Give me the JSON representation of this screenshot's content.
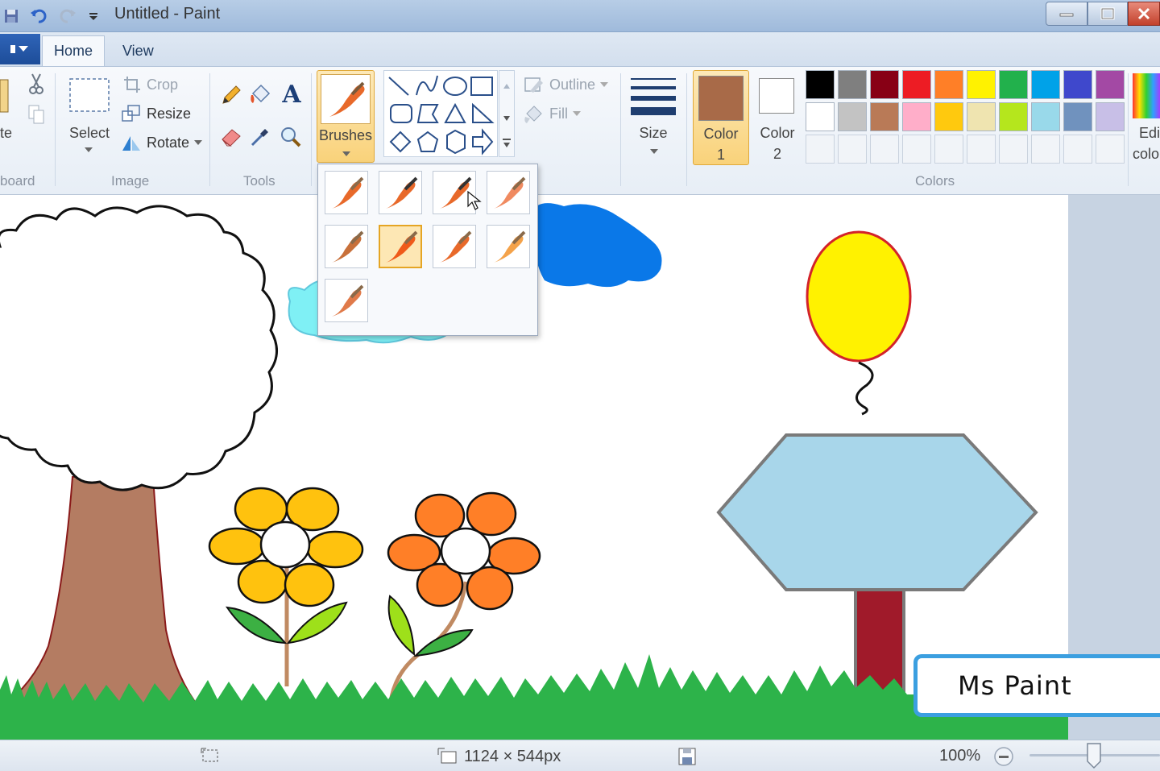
{
  "window": {
    "title": "Untitled - Paint"
  },
  "tabs": {
    "home": "Home",
    "view": "View"
  },
  "ribbon": {
    "clipboard": {
      "group_label": "board",
      "paste_label": "te"
    },
    "image": {
      "group_label": "Image",
      "select_label": "Select",
      "crop_label": "Crop",
      "resize_label": "Resize",
      "rotate_label": "Rotate"
    },
    "tools": {
      "group_label": "Tools"
    },
    "brushes": {
      "label": "Brushes"
    },
    "shapes": {
      "outline_label": "Outline",
      "fill_label": "Fill"
    },
    "size": {
      "label": "Size"
    },
    "colors": {
      "group_label": "Colors",
      "color1_label": "Color",
      "color1_num": "1",
      "color2_label": "Color",
      "color2_num": "2",
      "edit_colors_line1": "Edi",
      "edit_colors_line2": "colo",
      "color1": "#a86a48",
      "color2": "#ffffff",
      "palette_row1": [
        "#000000",
        "#7f7f7f",
        "#880015",
        "#ed1c24",
        "#ff7f27",
        "#fff200",
        "#22b14c",
        "#00a2e8",
        "#3f48cc",
        "#a349a4"
      ],
      "palette_row2": [
        "#ffffff",
        "#c3c3c3",
        "#b97a57",
        "#ffaec9",
        "#ffc90e",
        "#efe4b0",
        "#b5e61d",
        "#99d9ea",
        "#7092be",
        "#c8bfe7"
      ]
    }
  },
  "brush_menu": {
    "items": [
      "brush",
      "calligraphy-brush-1",
      "calligraphy-brush-2",
      "airbrush",
      "oil-brush",
      "crayon",
      "marker",
      "natural-pencil",
      "watercolor-brush"
    ],
    "selected_index": 5
  },
  "caption": {
    "text": "Ms Paint"
  },
  "status": {
    "dimensions": "1124 × 544px",
    "zoom": "100%"
  }
}
